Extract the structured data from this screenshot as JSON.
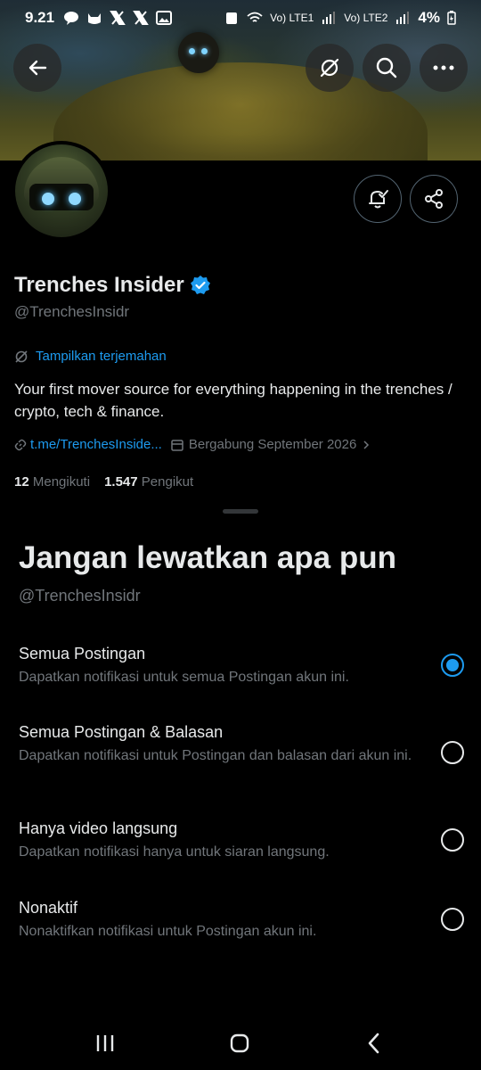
{
  "status_bar": {
    "time": "9.21",
    "signal_1": "Vo) LTE1",
    "signal_2": "Vo) LTE2",
    "battery": "4%"
  },
  "profile": {
    "name": "Trenches Insider",
    "handle": "@TrenchesInsidr",
    "translate_label": "Tampilkan terjemahan",
    "bio": "Your first mover source for everything happening in the trenches / crypto, tech & finance.",
    "link": "t.me/TrenchesInside...",
    "joined": "Bergabung September 2026",
    "following_count": "12",
    "following_label": "Mengikuti",
    "followers_count": "1.547",
    "followers_label": "Pengikut"
  },
  "sheet": {
    "title": "Jangan lewatkan apa pun",
    "handle": "@TrenchesInsidr",
    "options": [
      {
        "label": "Semua Postingan",
        "desc": "Dapatkan notifikasi untuk semua Postingan akun ini.",
        "selected": true
      },
      {
        "label": "Semua Postingan & Balasan",
        "desc": "Dapatkan notifikasi untuk Postingan dan balasan dari akun ini.",
        "selected": false
      },
      {
        "label": "Hanya video langsung",
        "desc": "Dapatkan notifikasi hanya untuk siaran langsung.",
        "selected": false
      },
      {
        "label": "Nonaktif",
        "desc": "Nonaktifkan notifikasi untuk Postingan akun ini.",
        "selected": false
      }
    ]
  },
  "colors": {
    "accent": "#1d9bf0",
    "muted": "#71767b",
    "text": "#e7e9ea",
    "background": "#000000"
  }
}
